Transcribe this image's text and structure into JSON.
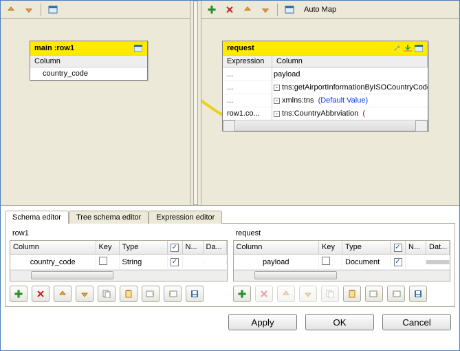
{
  "toolbars": {
    "left": {
      "up": "up",
      "down": "down",
      "window": "window"
    },
    "right": {
      "add": "add",
      "remove": "remove",
      "up": "up",
      "down": "down",
      "window": "window",
      "automap_label": "Auto Map"
    }
  },
  "left_node": {
    "title": "main :row1",
    "col_header": "Column",
    "rows": [
      "country_code"
    ]
  },
  "right_node": {
    "title": "request",
    "col_headers": {
      "expr": "Expression",
      "col": "Column"
    },
    "rows": [
      {
        "expr": "...",
        "indent": 0,
        "toggle": "",
        "label": "payload",
        "cls": ""
      },
      {
        "expr": "...",
        "indent": 1,
        "toggle": "-",
        "label": "tns:getAirportInformationByISOCountryCode",
        "cls": ""
      },
      {
        "expr": "...",
        "indent": 2,
        "toggle": "-",
        "label": "xmlns:tns",
        "extra": "(Default Value)",
        "cls": "blue"
      },
      {
        "expr": "row1.co...",
        "indent": 2,
        "toggle": "-",
        "label": "tns:CountryAbbrviation",
        "extra": "(",
        "cls": "red"
      }
    ]
  },
  "tabs": {
    "schema": "Schema editor",
    "tree": "Tree schema editor",
    "expr": "Expression editor"
  },
  "schema": {
    "left": {
      "title": "row1",
      "headers": {
        "col": "Column",
        "key": "Key",
        "type": "Type",
        "v": "✓",
        "n": "N...",
        "d": "Da..."
      },
      "row": {
        "col": "country_code",
        "key": false,
        "type": "String",
        "v": true,
        "n": "",
        "d": ""
      }
    },
    "right": {
      "title": "request",
      "headers": {
        "col": "Column",
        "key": "Key",
        "type": "Type",
        "v": "✓",
        "n": "N...",
        "d": "Dat..."
      },
      "row": {
        "col": "payload",
        "key": false,
        "type": "Document",
        "v": true,
        "n": "",
        "d": ""
      }
    }
  },
  "footer": {
    "apply": "Apply",
    "ok": "OK",
    "cancel": "Cancel"
  }
}
